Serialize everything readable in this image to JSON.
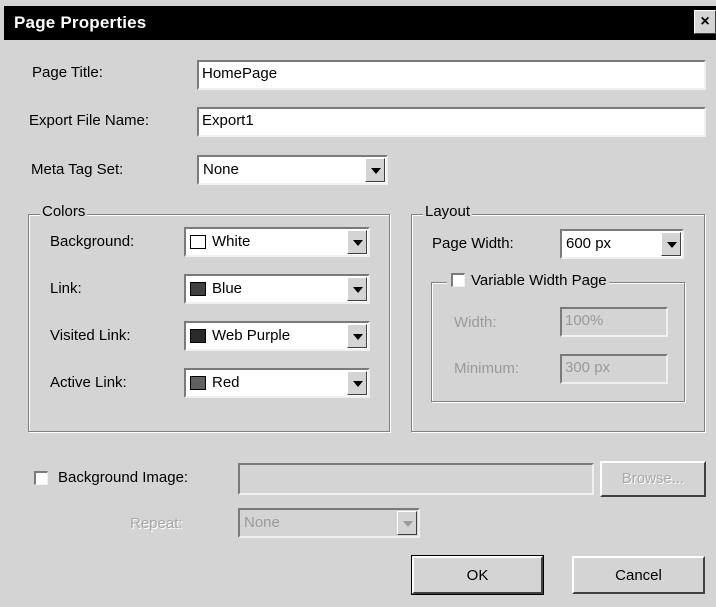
{
  "window": {
    "title": "Page Properties",
    "close_glyph": "×"
  },
  "fields": {
    "page_title_label": "Page Title:",
    "page_title_value": "HomePage",
    "export_label": "Export File Name:",
    "export_value": "Export1",
    "meta_label": "Meta Tag Set:",
    "meta_value": "None"
  },
  "colors_group": {
    "legend": "Colors",
    "background_label": "Background:",
    "background_value": "White",
    "background_swatch": "#ffffff",
    "link_label": "Link:",
    "link_value": "Blue",
    "link_swatch": "#404040",
    "visited_label": "Visited Link:",
    "visited_value": "Web Purple",
    "visited_swatch": "#2a2a2a",
    "active_label": "Active Link:",
    "active_value": "Red",
    "active_swatch": "#606060"
  },
  "layout_group": {
    "legend": "Layout",
    "page_width_label": "Page Width:",
    "page_width_value": "600 px",
    "variable_label": "Variable Width Page",
    "width_label": "Width:",
    "width_value": "100%",
    "minimum_label": "Minimum:",
    "minimum_value": "300 px"
  },
  "background_image": {
    "label": "Background Image:",
    "value": "",
    "browse_label": "Browse...",
    "repeat_label": "Repeat:",
    "repeat_value": "None"
  },
  "buttons": {
    "ok": "OK",
    "cancel": "Cancel"
  }
}
